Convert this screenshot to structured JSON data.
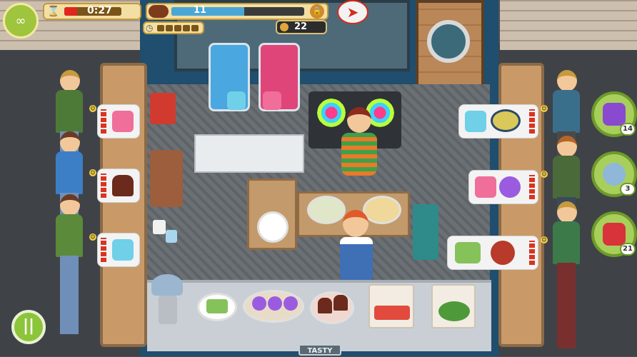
{
  "hud": {
    "timer_text": "0:27",
    "goal_count": "11",
    "goal_progress": 0.55,
    "level_stars_filled": 0,
    "level_stars_total": 5,
    "coins": "22",
    "sign_text": "TASTY"
  },
  "boosters": [
    {
      "name": "candy",
      "count": "14"
    },
    {
      "name": "snow-globe",
      "count": "3"
    },
    {
      "name": "roller-skate",
      "count": "21"
    }
  ],
  "customers_left": [
    {
      "order": "smoothie-cup"
    },
    {
      "order": "chocolate-cupcake"
    },
    {
      "order": "blue-smoothie"
    }
  ],
  "customers_right": [
    {
      "order": [
        "blue-smoothie",
        "noodle-bowl"
      ]
    },
    {
      "order": [
        "pink-smoothie",
        "purple-heart-cake"
      ]
    },
    {
      "order": [
        "green-cake-slice",
        "sushi-roll"
      ]
    }
  ],
  "counter_items": [
    "green-cake-slice",
    "purple-heart-cakes",
    "chocolate-cupcakes",
    "watermelon-slices",
    "salad"
  ],
  "colors": {
    "hud_frame": "#f3dfa3",
    "timer_red": "#e2261e",
    "goal_blue": "#49a7d6",
    "booster_green": "#a8cf5b",
    "truck_blue": "#1f4e6e"
  }
}
